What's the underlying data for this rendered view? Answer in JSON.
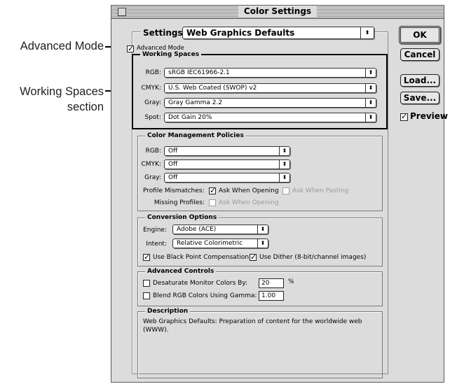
{
  "callouts": {
    "advanced_mode": "Advanced Mode",
    "working_spaces_line1": "Working Spaces",
    "working_spaces_line2": "section"
  },
  "dialog": {
    "title": "Color Settings",
    "settings_label": "Settings:",
    "settings_value": "Web Graphics Defaults",
    "advanced_mode": {
      "label": "Advanced Mode",
      "checked": true
    }
  },
  "working_spaces": {
    "title": "Working Spaces",
    "rows": [
      {
        "label": "RGB:",
        "value": "sRGB IEC61966-2.1"
      },
      {
        "label": "CMYK:",
        "value": "U.S. Web Coated (SWOP) v2"
      },
      {
        "label": "Gray:",
        "value": "Gray Gamma 2.2"
      },
      {
        "label": "Spot:",
        "value": "Dot Gain 20%"
      }
    ]
  },
  "policies": {
    "title": "Color Management Policies",
    "rows": [
      {
        "label": "RGB:",
        "value": "Off"
      },
      {
        "label": "CMYK:",
        "value": "Off"
      },
      {
        "label": "Gray:",
        "value": "Off"
      }
    ],
    "profile_mismatches_label": "Profile Mismatches:",
    "ask_when_opening": {
      "label": "Ask When Opening",
      "checked": true
    },
    "ask_when_pasting": {
      "label": "Ask When Pasting",
      "checked": false
    },
    "missing_profiles_label": "Missing Profiles:",
    "missing_ask_when_opening": {
      "label": "Ask When Opening",
      "checked": false
    }
  },
  "conversion": {
    "title": "Conversion Options",
    "engine_label": "Engine:",
    "engine_value": "Adobe (ACE)",
    "intent_label": "Intent:",
    "intent_value": "Relative Colorimetric",
    "black_point": {
      "label": "Use Black Point Compensation",
      "checked": true
    },
    "dither": {
      "label": "Use Dither (8-bit/channel images)",
      "checked": true
    }
  },
  "advanced": {
    "title": "Advanced Controls",
    "desaturate": {
      "label": "Desaturate Monitor Colors By:",
      "checked": false,
      "value": "20",
      "unit": "%"
    },
    "blend": {
      "label": "Blend RGB Colors Using Gamma:",
      "checked": false,
      "value": "1.00"
    }
  },
  "description": {
    "title": "Description",
    "text": "Web Graphics Defaults:  Preparation of content for the worldwide web (WWW)."
  },
  "buttons": {
    "ok": "OK",
    "cancel": "Cancel",
    "load": "Load...",
    "save": "Save...",
    "preview": {
      "label": "Preview",
      "checked": true
    }
  },
  "icons": {
    "popup_arrow": "updown-arrows-icon",
    "check": "checkmark-icon"
  }
}
